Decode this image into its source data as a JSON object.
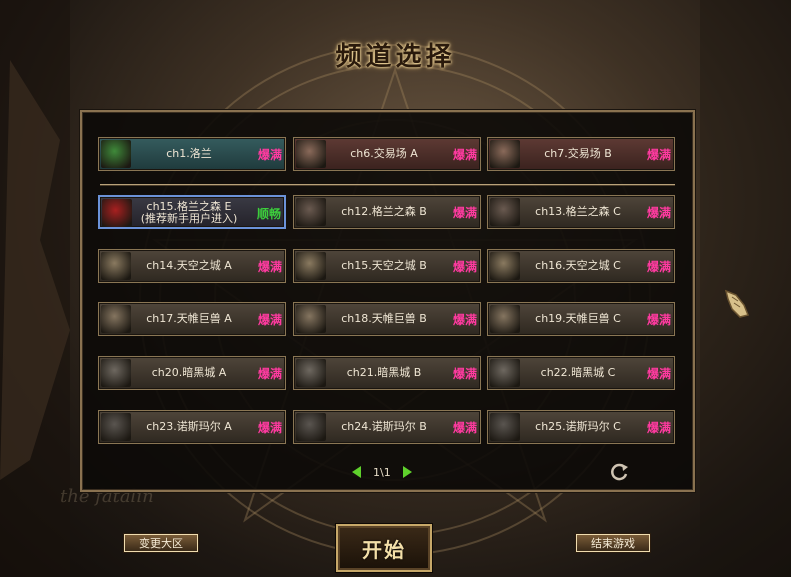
{
  "screen": {
    "title": "频道选择",
    "watermark": "the fatalin"
  },
  "featured_channels": [
    {
      "label": "ch1.洛兰",
      "status": "爆满",
      "thumb_color": "#3f8a3a",
      "style": "teal",
      "icon": "leaf-icon"
    },
    {
      "label": "ch6.交易场 A",
      "status": "爆满",
      "thumb_color": "#8a6a5a",
      "style": "maroon",
      "icon": "merchant-icon"
    },
    {
      "label": "ch7.交易场 B",
      "status": "爆满",
      "thumb_color": "#8a6a5a",
      "style": "maroon",
      "icon": "merchant-icon"
    }
  ],
  "channels": [
    {
      "label": "ch15.格兰之森 E\n(推荐新手用户进入)",
      "status": "顺畅",
      "status_type": "ok",
      "thumb_color": "#a82020",
      "selected": true,
      "icon": "red-bird-icon"
    },
    {
      "label": "ch12.格兰之森 B",
      "status": "爆满",
      "status_type": "full",
      "thumb_color": "#6a5a50",
      "icon": "grand-flores-icon"
    },
    {
      "label": "ch13.格兰之森 C",
      "status": "爆满",
      "status_type": "full",
      "thumb_color": "#6a5a50",
      "icon": "grand-flores-icon"
    },
    {
      "label": "ch14.天空之城 A",
      "status": "爆满",
      "status_type": "full",
      "thumb_color": "#8a7a60",
      "icon": "sky-tower-icon"
    },
    {
      "label": "ch15.天空之城 B",
      "status": "爆满",
      "status_type": "full",
      "thumb_color": "#8a7a60",
      "icon": "sky-tower-icon"
    },
    {
      "label": "ch16.天空之城 C",
      "status": "爆满",
      "status_type": "full",
      "thumb_color": "#8a7a60",
      "icon": "sky-tower-icon"
    },
    {
      "label": "ch17.天帷巨兽 A",
      "status": "爆满",
      "status_type": "full",
      "thumb_color": "#857560",
      "icon": "behemoth-icon"
    },
    {
      "label": "ch18.天帷巨兽 B",
      "status": "爆满",
      "status_type": "full",
      "thumb_color": "#857560",
      "icon": "behemoth-icon"
    },
    {
      "label": "ch19.天帷巨兽 C",
      "status": "爆满",
      "status_type": "full",
      "thumb_color": "#857560",
      "icon": "behemoth-icon"
    },
    {
      "label": "ch20.暗黑城 A",
      "status": "爆满",
      "status_type": "full",
      "thumb_color": "#6e6860",
      "icon": "dark-city-icon"
    },
    {
      "label": "ch21.暗黑城 B",
      "status": "爆满",
      "status_type": "full",
      "thumb_color": "#6e6860",
      "icon": "dark-city-icon"
    },
    {
      "label": "ch22.暗黑城 C",
      "status": "爆满",
      "status_type": "full",
      "thumb_color": "#6e6860",
      "icon": "dark-city-icon"
    },
    {
      "label": "ch23.诺斯玛尔 A",
      "status": "爆满",
      "status_type": "full",
      "thumb_color": "#5a5550",
      "icon": "noshmar-icon"
    },
    {
      "label": "ch24.诺斯玛尔 B",
      "status": "爆满",
      "status_type": "full",
      "thumb_color": "#5a5550",
      "icon": "noshmar-icon"
    },
    {
      "label": "ch25.诺斯玛尔 C",
      "status": "爆满",
      "status_type": "full",
      "thumb_color": "#5a5550",
      "icon": "noshmar-icon"
    }
  ],
  "pager": {
    "text": "1\\1"
  },
  "buttons": {
    "change_server": "变更大区",
    "start": "开始",
    "exit": "结束游戏"
  }
}
